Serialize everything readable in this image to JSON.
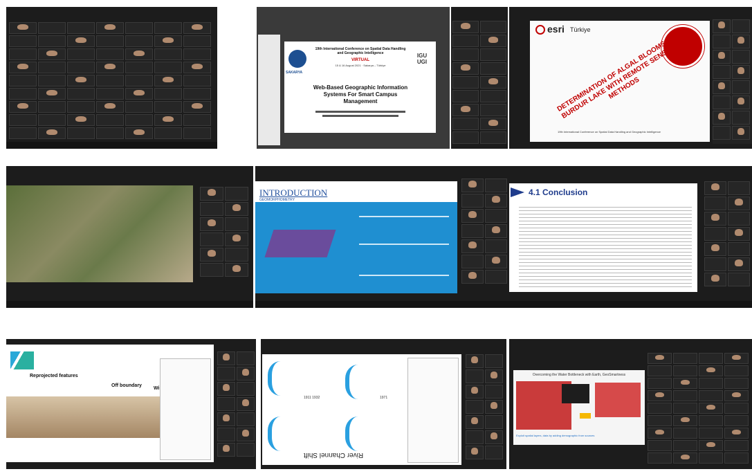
{
  "panels": {
    "p2": {
      "conference": "19th International Conference on Spatial Data Handling and Geographic Intelligence",
      "virtual": "VIRTUAL",
      "dates": "15 & 16 August 2021 · Sakarya – Türkiye",
      "title": "Web-Based Geographic Information Systems For Smart Campus Management",
      "logo_left": "SAKARYA",
      "logo_right": "IGU UGI"
    },
    "p4": {
      "brand": "esri",
      "brand_sub": "Türkiye",
      "title": "DETERMINATION OF ALGAL BLOOMS IN BURDUR LAKE WITH REMOTE SENSING METHODS",
      "footer": "19th International Conference on Spatial Data Handling and Geographic Intelligence"
    },
    "p6": {
      "title": "INTRODUCTION",
      "subtitle": "GEOMORPHOMETRY"
    },
    "p7": {
      "title": "4.1 Conclusion"
    },
    "p8": {
      "label1": "Reprojected features",
      "label2": "Off boundary",
      "label3": "Wi"
    },
    "p9": {
      "caption": "River Channel Shift",
      "y1": "1911 1932",
      "y2": "1971"
    },
    "p10": {
      "title": "Overcoming the Water Bottleneck with Earth, GeoSmartness",
      "caption": "Exploit spatial layers, data by adding demographic from sources"
    }
  }
}
